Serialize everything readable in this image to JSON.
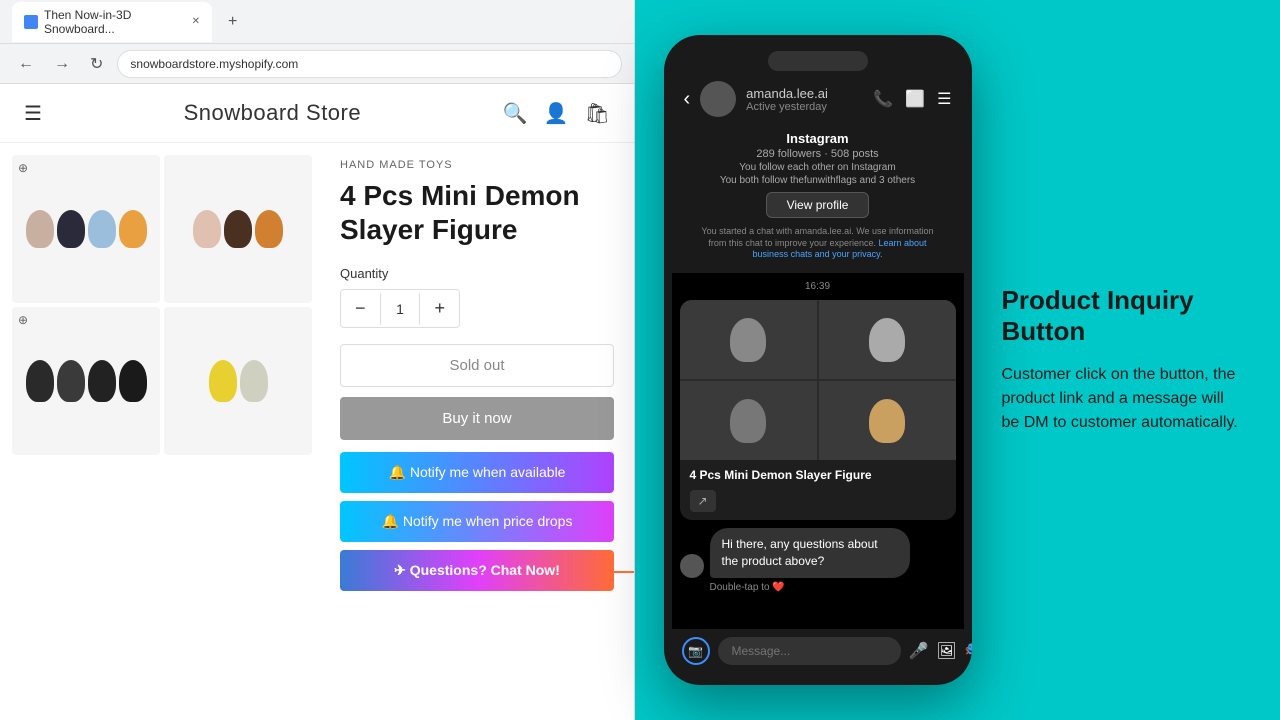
{
  "browser": {
    "tab_title": "Then Now-in-3D Snowboard...",
    "address": "snowboardstore.myshopify.com",
    "nav_back_enabled": true,
    "nav_forward_enabled": false
  },
  "store": {
    "name": "Snowboard Store",
    "category": "HAND MADE TOYS",
    "product_name": "4 Pcs Mini Demon Slayer Figure",
    "quantity": "1",
    "quantity_label": "Quantity",
    "sold_out_label": "Sold out",
    "buy_now_label": "Buy it now",
    "notify_available_label": "🔔 Notify me when available",
    "notify_price_label": "🔔 Notify me when price drops",
    "chat_label": "✈ Questions? Chat Now!"
  },
  "instagram": {
    "platform": "Instagram",
    "status": "Active yesterday",
    "followers": "289 followers · 508 posts",
    "follow_status": "You follow each other on Instagram",
    "mutual": "You both follow thefunwithflags and 3 others",
    "view_profile": "View profile",
    "disclaimer": "You started a chat with amanda.lee.ai. We use information from this chat to improve your experience.",
    "disclaimer_link": "Learn about business chats and your privacy.",
    "time": "16:39",
    "product_title": "4 Pcs Mini Demon Slayer Figure",
    "dm_message": "Hi there, any questions about the product above?",
    "dm_reaction": "Double-tap to ❤️",
    "message_placeholder": "Message..."
  },
  "promo": {
    "title": "Product Inquiry Button",
    "body": "Customer click on the button, the product link and a message will be DM to customer automatically."
  },
  "icons": {
    "search": "🔍",
    "account": "👤",
    "cart": "🛍",
    "hamburger": "☰",
    "minus": "−",
    "plus": "+",
    "back_arrow": "←",
    "forward_arrow": "→",
    "refresh": "↻",
    "phone": "📞",
    "video": "⬜",
    "menu": "☰",
    "send": "✈",
    "mic": "🎤",
    "gallery": "🖼",
    "sticker": "🎭",
    "camera": "📷",
    "link_icon": "↗"
  }
}
